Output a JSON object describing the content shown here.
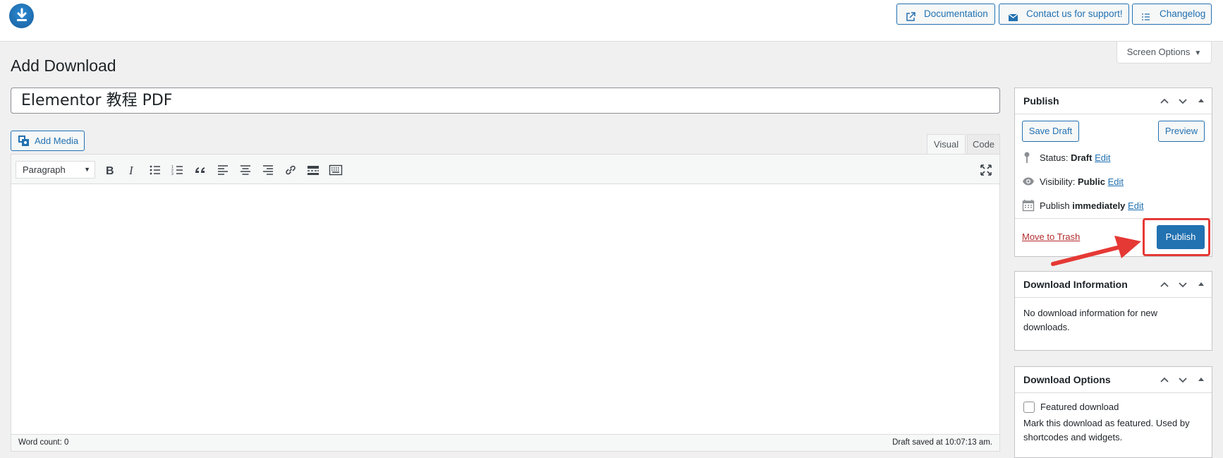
{
  "header": {
    "logo_icon": "download-icon",
    "links": [
      {
        "label": "Documentation",
        "icon": "external-link-icon"
      },
      {
        "label": "Contact us for support!",
        "icon": "envelope-icon"
      },
      {
        "label": "Changelog",
        "icon": "list-icon"
      }
    ]
  },
  "screen_options": {
    "label": "Screen Options"
  },
  "page": {
    "title": "Add Download",
    "post_title": "Elementor 教程 PDF"
  },
  "editor": {
    "add_media": "Add Media",
    "tabs": {
      "visual": "Visual",
      "code": "Code"
    },
    "format_select": "Paragraph",
    "toolbar_icons": [
      "bold-icon",
      "italic-icon",
      "bulleted-list-icon",
      "numbered-list-icon",
      "blockquote-icon",
      "align-left-icon",
      "align-center-icon",
      "align-right-icon",
      "link-icon",
      "read-more-icon",
      "toolbar-toggle-icon",
      "fullscreen-icon"
    ],
    "word_count": "Word count: 0",
    "draft_saved": "Draft saved at 10:07:13 am."
  },
  "publish_box": {
    "title": "Publish",
    "save_draft": "Save Draft",
    "preview": "Preview",
    "status_label": "Status:",
    "status_value": "Draft",
    "visibility_label": "Visibility:",
    "visibility_value": "Public",
    "publish_label": "Publish",
    "publish_value": "immediately",
    "edit": "Edit",
    "move_to_trash": "Move to Trash",
    "publish_button": "Publish"
  },
  "download_information": {
    "title": "Download Information",
    "text": "No download information for new downloads."
  },
  "download_options": {
    "title": "Download Options",
    "featured_label": "Featured download",
    "featured_checked": false,
    "description": "Mark this download as featured. Used by shortcodes and widgets."
  },
  "colors": {
    "accent": "#2271b1",
    "danger": "#b32d2e",
    "annotation": "#e53935"
  }
}
